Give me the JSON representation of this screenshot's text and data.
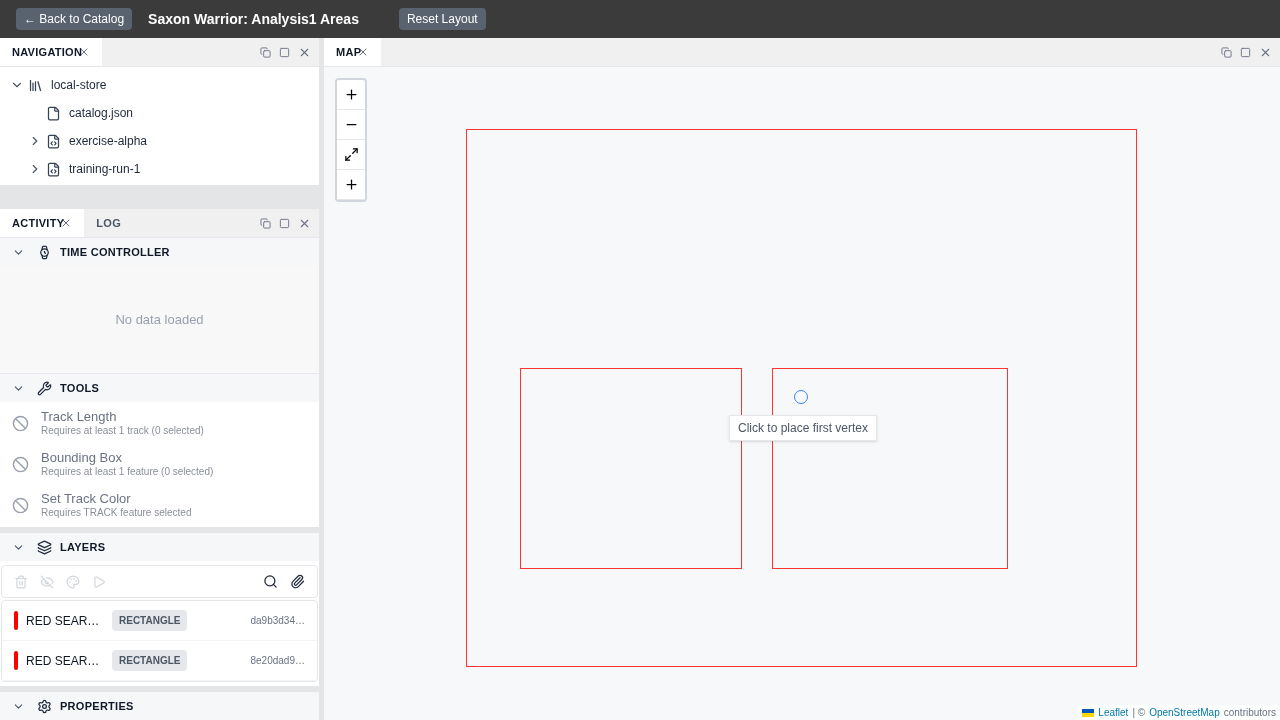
{
  "header": {
    "back_button": "← Back to Catalog",
    "title": "Saxon Warrior: Analysis1 Areas",
    "reset_button": "Reset Layout"
  },
  "navigation_panel": {
    "tabs": [
      {
        "label": "NAVIGATION",
        "selected": true
      }
    ],
    "tree": [
      {
        "label": "local-store",
        "kind": "store",
        "expanded": true,
        "children": [
          {
            "label": "catalog.json",
            "kind": "file"
          },
          {
            "label": "exercise-alpha",
            "kind": "code",
            "expanded": false
          },
          {
            "label": "training-run-1",
            "kind": "code",
            "expanded": false
          }
        ]
      }
    ]
  },
  "activity_panel": {
    "tabs": [
      {
        "label": "ACTIVITY",
        "selected": true
      },
      {
        "label": "LOG",
        "selected": false
      }
    ],
    "time_controller": {
      "title": "TIME CONTROLLER",
      "expanded": true,
      "empty_text": "No data loaded"
    },
    "tools": {
      "title": "TOOLS",
      "expanded": true,
      "items": [
        {
          "name": "Track Length",
          "hint": "Requires at least 1 track (0 selected)",
          "disabled": true
        },
        {
          "name": "Bounding Box",
          "hint": "Requires at least 1 feature (0 selected)",
          "disabled": true
        },
        {
          "name": "Set Track Color",
          "hint": "Requires TRACK feature selected",
          "disabled": true
        }
      ]
    },
    "layers": {
      "title": "LAYERS",
      "expanded": true,
      "items": [
        {
          "name": "RED SEAR…",
          "type": "RECTANGLE",
          "id": "da9b3d34…",
          "color": "#ff0000"
        },
        {
          "name": "RED SEAR…",
          "type": "RECTANGLE",
          "id": "8e20dad9…",
          "color": "#ff0000"
        }
      ]
    },
    "properties": {
      "title": "PROPERTIES",
      "expanded": true
    }
  },
  "map_panel": {
    "tabs": [
      {
        "label": "MAP",
        "selected": true
      }
    ],
    "tooltip": "Click to place first vertex",
    "attribution": {
      "leaflet": "Leaflet",
      "separator": "| ©",
      "osm": "OpenStreetMap",
      "suffix": "contributors"
    }
  }
}
